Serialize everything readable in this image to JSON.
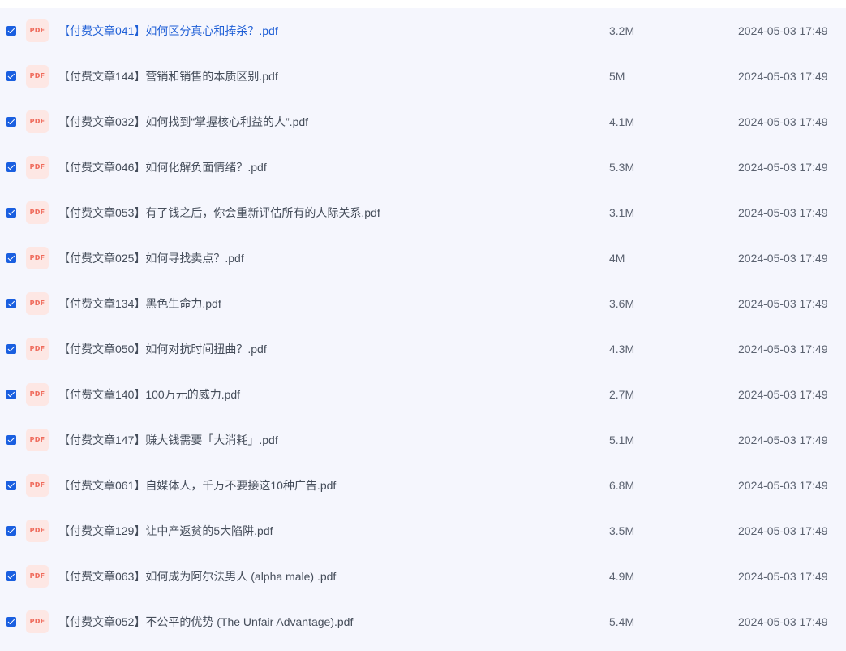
{
  "icon_label": "PDF",
  "colors": {
    "list_background": "#f5f6fd",
    "checkbox": "#1a5fe0",
    "pdf_icon_bg": "#fde7e4",
    "pdf_icon_text": "#ef6a5b",
    "highlight_text": "#1f5fd6"
  },
  "files": [
    {
      "name": "【付费文章041】如何区分真心和捧杀？.pdf",
      "size": "3.2M",
      "date": "2024-05-03 17:49",
      "checked": true,
      "highlighted": true
    },
    {
      "name": "【付费文章144】营销和销售的本质区别.pdf",
      "size": "5M",
      "date": "2024-05-03 17:49",
      "checked": true,
      "highlighted": false
    },
    {
      "name": "【付费文章032】如何找到“掌握核心利益的人”.pdf",
      "size": "4.1M",
      "date": "2024-05-03 17:49",
      "checked": true,
      "highlighted": false
    },
    {
      "name": "【付费文章046】如何化解负面情绪？.pdf",
      "size": "5.3M",
      "date": "2024-05-03 17:49",
      "checked": true,
      "highlighted": false
    },
    {
      "name": "【付费文章053】有了钱之后，你会重新评估所有的人际关系.pdf",
      "size": "3.1M",
      "date": "2024-05-03 17:49",
      "checked": true,
      "highlighted": false
    },
    {
      "name": "【付费文章025】如何寻找卖点？.pdf",
      "size": "4M",
      "date": "2024-05-03 17:49",
      "checked": true,
      "highlighted": false
    },
    {
      "name": "【付费文章134】黑色生命力.pdf",
      "size": "3.6M",
      "date": "2024-05-03 17:49",
      "checked": true,
      "highlighted": false
    },
    {
      "name": "【付费文章050】如何对抗时间扭曲？.pdf",
      "size": "4.3M",
      "date": "2024-05-03 17:49",
      "checked": true,
      "highlighted": false
    },
    {
      "name": "【付费文章140】100万元的威力.pdf",
      "size": "2.7M",
      "date": "2024-05-03 17:49",
      "checked": true,
      "highlighted": false
    },
    {
      "name": "【付费文章147】赚大钱需要「大消耗」.pdf",
      "size": "5.1M",
      "date": "2024-05-03 17:49",
      "checked": true,
      "highlighted": false
    },
    {
      "name": "【付费文章061】自媒体人，千万不要接这10种广告.pdf",
      "size": "6.8M",
      "date": "2024-05-03 17:49",
      "checked": true,
      "highlighted": false
    },
    {
      "name": "【付费文章129】让中产返贫的5大陷阱.pdf",
      "size": "3.5M",
      "date": "2024-05-03 17:49",
      "checked": true,
      "highlighted": false
    },
    {
      "name": "【付费文章063】如何成为阿尔法男人 (alpha male) .pdf",
      "size": "4.9M",
      "date": "2024-05-03 17:49",
      "checked": true,
      "highlighted": false
    },
    {
      "name": "【付费文章052】不公平的优势 (The Unfair Advantage).pdf",
      "size": "5.4M",
      "date": "2024-05-03 17:49",
      "checked": true,
      "highlighted": false
    }
  ]
}
